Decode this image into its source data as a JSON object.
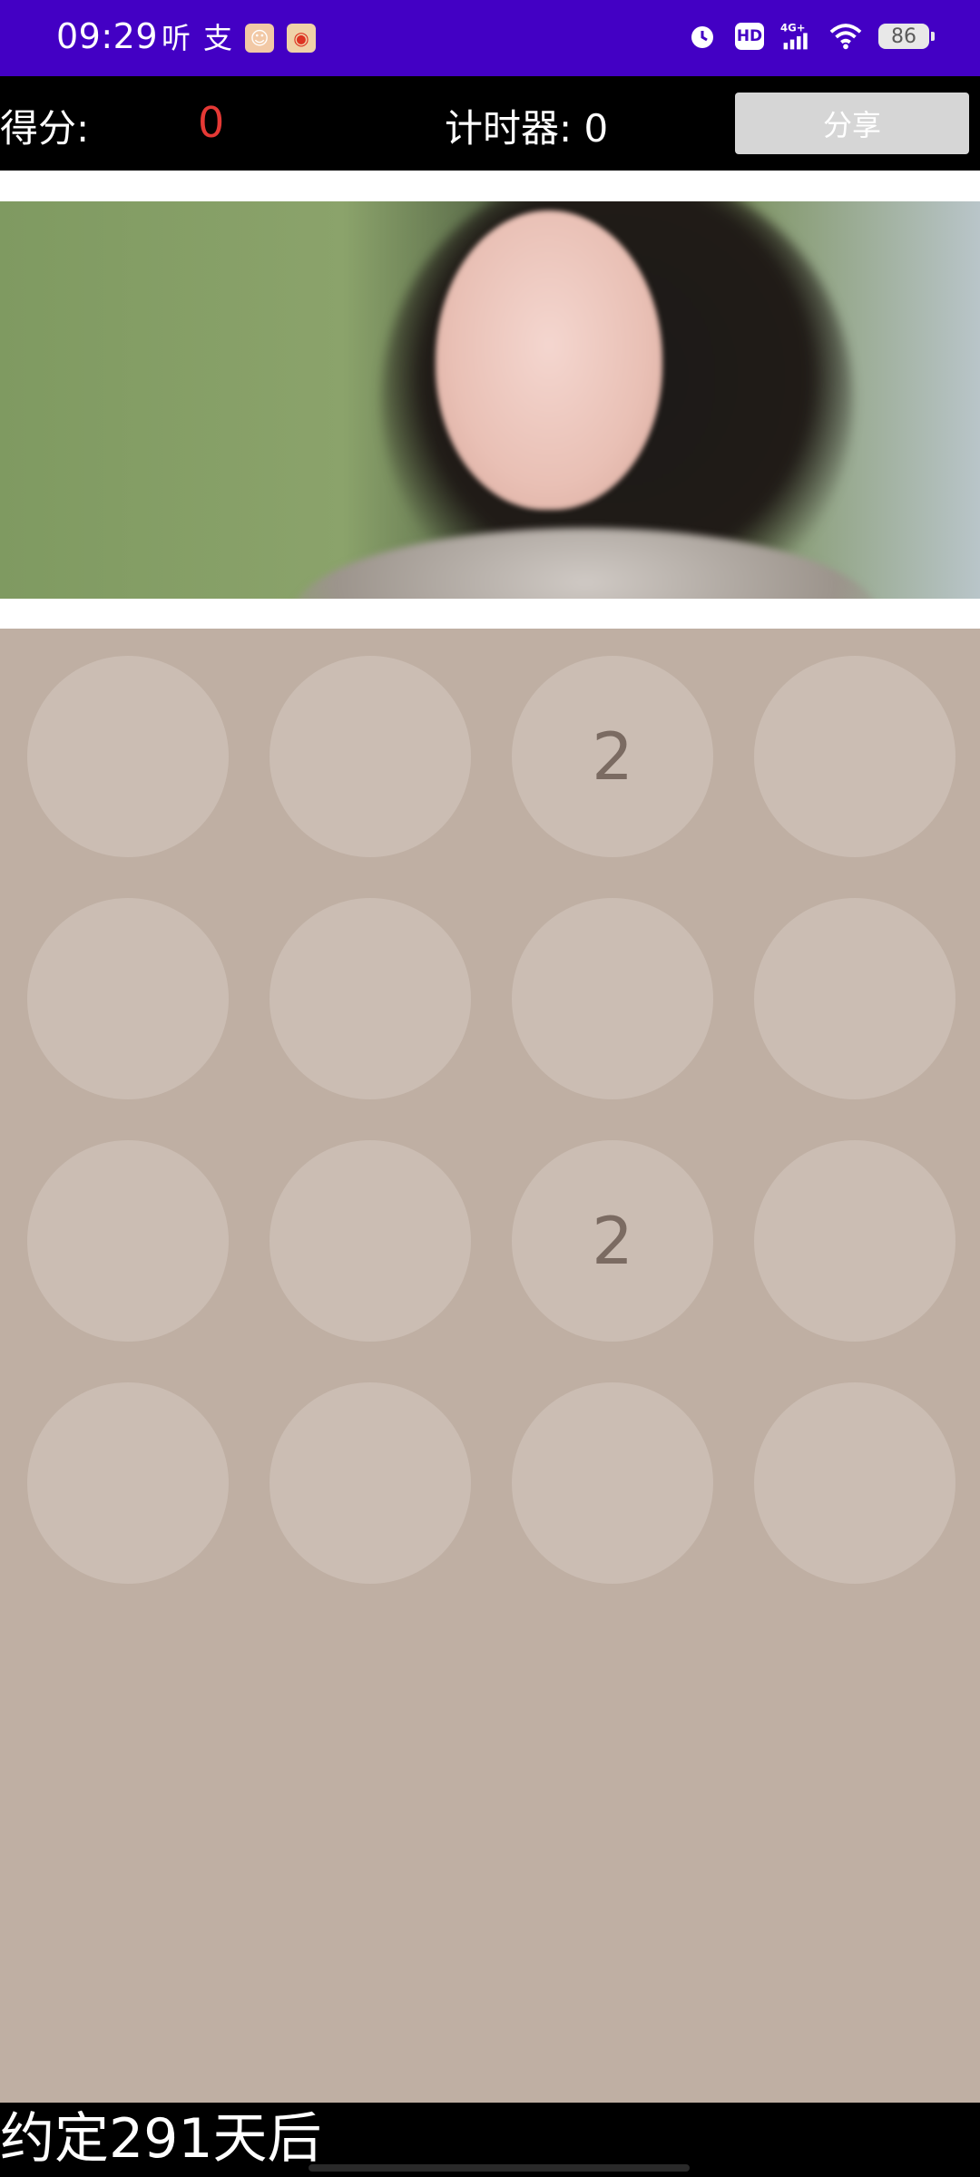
{
  "status_bar": {
    "time": "09:29",
    "left_glyph_1": "听",
    "left_glyph_2": "支",
    "network": "4G",
    "hd": "HD",
    "battery": "86",
    "colors": {
      "background": "#4300c4"
    }
  },
  "header": {
    "score_label": "得分:",
    "score_value": "0",
    "timer_text": "计时器: 0",
    "share_label": "分享"
  },
  "board": {
    "tiles": [
      "",
      "",
      "2",
      "",
      "",
      "",
      "",
      "",
      "",
      "",
      "2",
      "",
      "",
      "",
      "",
      ""
    ],
    "colors": {
      "background": "#bfafa3",
      "tile": "#cbbdb3",
      "tile_text": "#7b6b62"
    }
  },
  "footer": {
    "text": "约定291天后"
  }
}
